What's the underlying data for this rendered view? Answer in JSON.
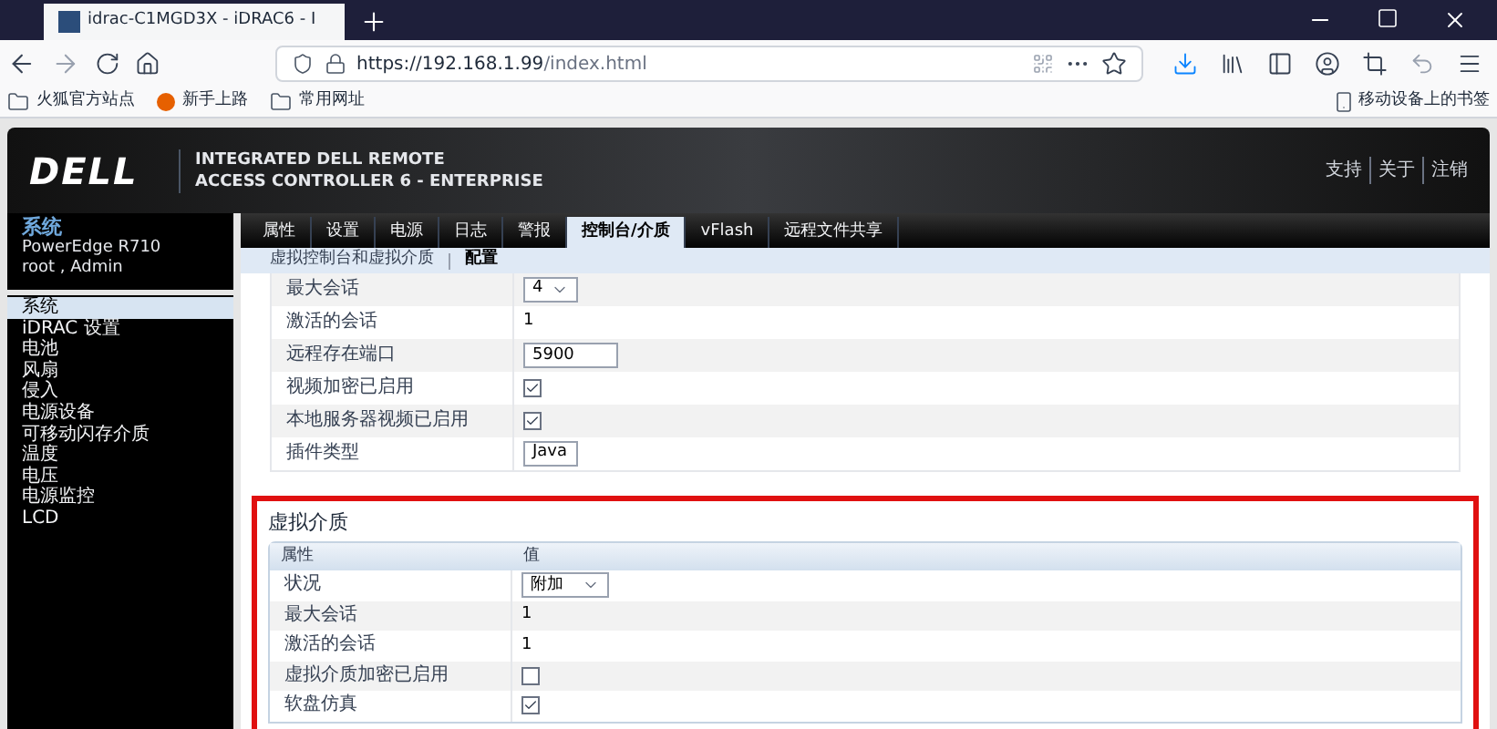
{
  "browser": {
    "tab_title": "idrac-C1MGD3X - iDRAC6 - I",
    "url_host": "https://192.168.1.99",
    "url_path": "/index.html",
    "bookmarks": [
      "火狐官方站点",
      "新手上路",
      "常用网址"
    ],
    "mobile_bookmarks": "移动设备上的书签"
  },
  "header": {
    "logo": "DELL",
    "title_lines": [
      "INTEGRATED DELL REMOTE",
      "ACCESS CONTROLLER 6 - ENTERPRISE"
    ],
    "links": [
      "支持",
      "关于",
      "注销"
    ]
  },
  "sidebar": {
    "title": "系统",
    "model": "PowerEdge R710",
    "user": "root , Admin",
    "items": [
      {
        "label": "系统",
        "selected": true
      },
      {
        "label": "iDRAC 设置",
        "selected": false
      },
      {
        "label": "电池",
        "selected": false
      },
      {
        "label": "风扇",
        "selected": false
      },
      {
        "label": "侵入",
        "selected": false
      },
      {
        "label": "电源设备",
        "selected": false
      },
      {
        "label": "可移动闪存介质",
        "selected": false
      },
      {
        "label": "温度",
        "selected": false
      },
      {
        "label": "电压",
        "selected": false
      },
      {
        "label": "电源监控",
        "selected": false
      },
      {
        "label": "LCD",
        "selected": false
      }
    ]
  },
  "tabs": [
    {
      "label": "属性",
      "selected": false
    },
    {
      "label": "设置",
      "selected": false
    },
    {
      "label": "电源",
      "selected": false
    },
    {
      "label": "日志",
      "selected": false
    },
    {
      "label": "警报",
      "selected": false
    },
    {
      "label": "控制台/介质",
      "selected": true
    },
    {
      "label": "vFlash",
      "selected": false
    },
    {
      "label": "远程文件共享",
      "selected": false
    }
  ],
  "subtabs": [
    {
      "label": "虚拟控制台和虚拟介质",
      "selected": false
    },
    {
      "label": "配置",
      "selected": true
    }
  ],
  "console_rows": [
    {
      "label": "最大会话",
      "kind": "select",
      "value": "4"
    },
    {
      "label": "激活的会话",
      "kind": "text",
      "value": "1"
    },
    {
      "label": "远程存在端口",
      "kind": "input",
      "value": "5900"
    },
    {
      "label": "视频加密已启用",
      "kind": "checkbox",
      "checked": true
    },
    {
      "label": "本地服务器视频已启用",
      "kind": "checkbox",
      "checked": true
    },
    {
      "label": "插件类型",
      "kind": "select",
      "value": "Java"
    }
  ],
  "virtual_media": {
    "title": "虚拟介质",
    "columns": [
      "属性",
      "值"
    ],
    "rows": [
      {
        "label": "状况",
        "kind": "select",
        "value": "附加"
      },
      {
        "label": "最大会话",
        "kind": "text",
        "value": "1"
      },
      {
        "label": "激活的会话",
        "kind": "text",
        "value": "1"
      },
      {
        "label": "虚拟介质加密已启用",
        "kind": "checkbox",
        "checked": false
      },
      {
        "label": "软盘仿真",
        "kind": "checkbox",
        "checked": true
      }
    ]
  }
}
